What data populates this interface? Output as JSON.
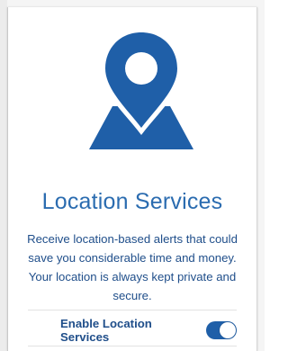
{
  "hero": {
    "icon": "map-location-pin-icon",
    "color": "#1f5fa8"
  },
  "title": "Location Services",
  "description": "Receive location-based alerts that could save you considerable time and money. Your location is always kept private and secure.",
  "toggle": {
    "label": "Enable Location Services",
    "state": "on",
    "accent_color": "#1f5fa8"
  },
  "colors": {
    "title": "#2b6cb0",
    "body": "#1f4e8a"
  }
}
